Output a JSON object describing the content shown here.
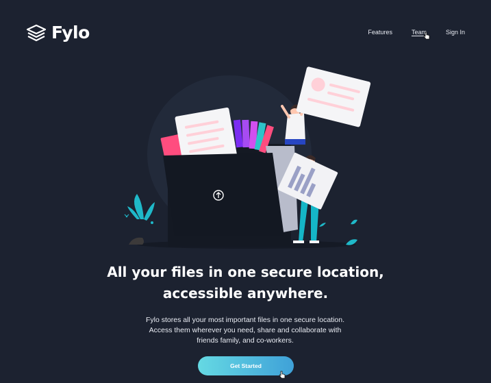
{
  "brand": {
    "name": "Fylo",
    "icon": "layers-icon"
  },
  "nav": {
    "items": [
      {
        "label": "Features",
        "active": false
      },
      {
        "label": "Team",
        "active": true
      },
      {
        "label": "Sign In",
        "active": false
      }
    ]
  },
  "hero": {
    "title_line1": "All your files in one secure location,",
    "title_line2": "accessible anywhere.",
    "description_line1": "Fylo stores all your most important files in one secure location.",
    "description_line2": "Access them wherever you need, share and collaborate with",
    "description_line3": "friends family, and co-workers.",
    "cta_label": "Get Started"
  },
  "colors": {
    "background": "#1c2230",
    "accent_start": "#65d9e3",
    "accent_end": "#3fa1d8",
    "pink": "#ff4d7f",
    "teal": "#1fb9c9"
  }
}
